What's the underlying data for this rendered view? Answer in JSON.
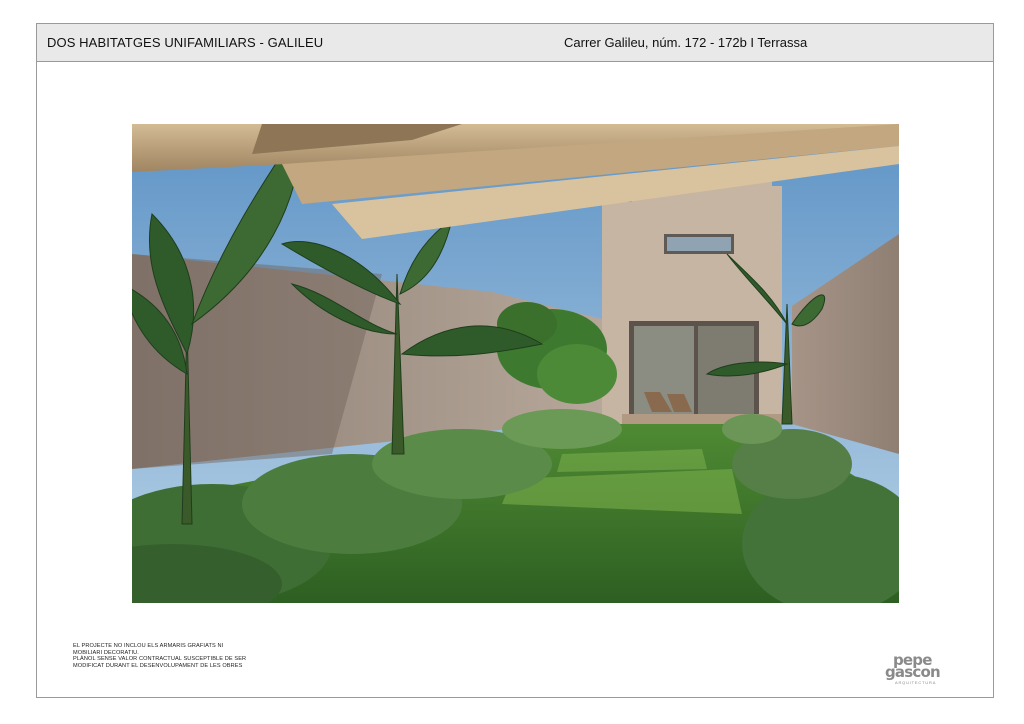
{
  "header": {
    "title": "DOS HABITATGES UNIFAMILIARS - GALILEU",
    "address": "Carrer Galileu, núm. 172 - 172b I Terrassa"
  },
  "notes": [
    "EL PROJECTE NO INCLOU ELS ARMARIS GRAFIATS NI",
    "MOBILIARI DECORATIU.",
    "PLÀNOL SENSE VALOR CONTRACTUAL SUSCEPTIBLE DE SER",
    "MODIFICAT DURANT EL DESENVOLUPAMENT DE LES OBRES"
  ],
  "logo": {
    "line1": "pepe",
    "line2": "gascon",
    "sub": "ARQUITECTURA"
  },
  "colors": {
    "header_bg": "#e9e9e9",
    "border": "#9a9a9a",
    "sky": "#7aa7cf",
    "wall": "#a7958a",
    "grass": "#3f7a2c",
    "logo_gray": "#8a8a8a"
  }
}
